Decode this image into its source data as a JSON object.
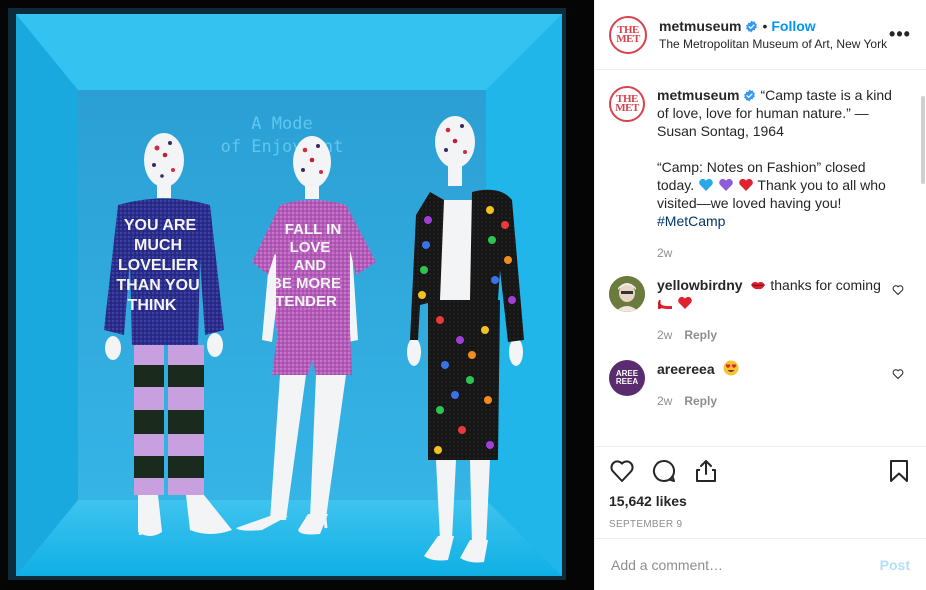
{
  "post": {
    "account": {
      "username": "metmuseum",
      "verified": true,
      "follow_label": "Follow",
      "separator": "•",
      "location": "The Metropolitan Museum of Art, New York",
      "logo_text_top": "THE",
      "logo_text_bottom": "MET"
    },
    "photo": {
      "wall_text_line1": "A Mode",
      "wall_text_line2": "of Enjoyment",
      "shirt1_lines": [
        "YOU ARE",
        "MUCH",
        "LOVELIER",
        "THAN YOU",
        "THINK"
      ],
      "shirt2_lines": [
        "FALL IN",
        "LOVE",
        "AND",
        "BE MORE",
        "TENDER"
      ],
      "colors": {
        "vitrine": "#19b7e8",
        "wall": "#2fa6d9",
        "frame": "#0f0f0f"
      }
    },
    "caption": {
      "username": "metmuseum",
      "line_a": "“Camp taste is a kind of love, love for human nature.” — Susan Sontag, 1964",
      "line_b_start": "“Camp: Notes on Fashion” closed today.",
      "line_b_end": "Thank you to all who visited—we loved having you!",
      "hashtag": "#MetCamp",
      "time": "2w"
    },
    "comments": [
      {
        "username": "yellowbirdny",
        "text_before": "thanks for coming",
        "time": "2w",
        "reply_label": "Reply"
      },
      {
        "username": "areereea",
        "avatar_text_top": "AREE",
        "avatar_text_bottom": "REEA",
        "time": "2w",
        "reply_label": "Reply"
      }
    ],
    "likes": "15,642 likes",
    "date": "SEPTEMBER 9",
    "comment_input": {
      "placeholder": "Add a comment…",
      "post_label": "Post"
    },
    "more_label": "•••",
    "icons": {
      "like": "heart-icon",
      "comment": "comment-bubble-icon",
      "share": "share-icon",
      "save": "bookmark-icon",
      "more": "more-options-icon",
      "verified": "verified-badge-icon"
    },
    "accent_colors": {
      "link": "#0095f6",
      "hashtag": "#00376b",
      "muted": "#8e8e8e",
      "post_disabled": "#b2dffc"
    }
  }
}
